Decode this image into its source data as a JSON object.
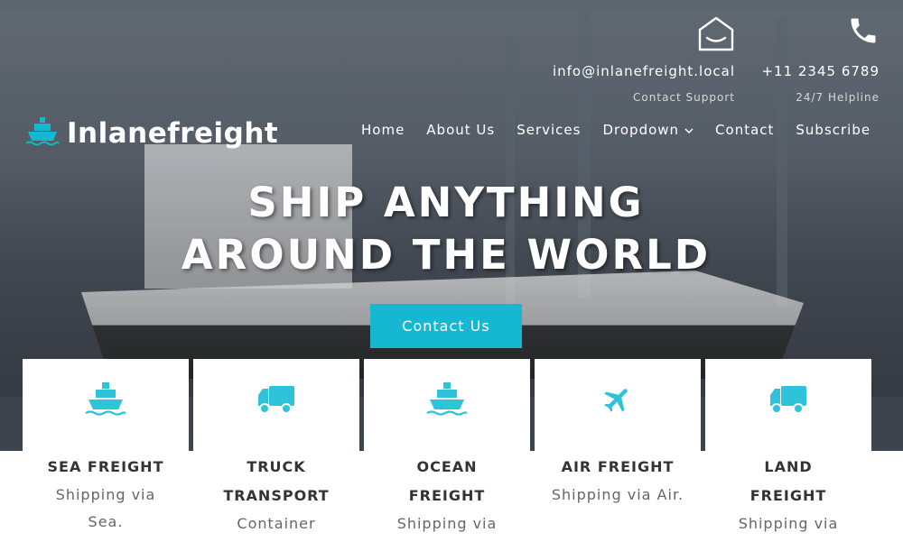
{
  "brand": {
    "name": "Inlanefreight",
    "icon": "ship-icon"
  },
  "contact": {
    "email": {
      "value": "info@inlanefreight.local",
      "label": "Contact Support",
      "icon": "envelope-open-icon"
    },
    "phone": {
      "value": "+11 2345 6789",
      "label": "24/7 Helpline",
      "icon": "phone-icon"
    }
  },
  "nav": {
    "items": [
      {
        "label": "Home"
      },
      {
        "label": "About Us"
      },
      {
        "label": "Services"
      },
      {
        "label": "Dropdown"
      },
      {
        "label": "Contact"
      },
      {
        "label": "Subscribe"
      }
    ]
  },
  "hero": {
    "line1": "SHIP ANYTHING",
    "line2": "AROUND THE WORLD",
    "cta": "Contact Us"
  },
  "services": [
    {
      "title": "SEA FREIGHT",
      "desc": "Shipping via Sea.",
      "icon": "ship-icon"
    },
    {
      "title": "TRUCK TRANSPORT",
      "desc": "Container Shipping.",
      "icon": "truck-icon"
    },
    {
      "title": "OCEAN FREIGHT",
      "desc": "Shipping via Ocean.",
      "icon": "ship-icon"
    },
    {
      "title": "AIR FREIGHT",
      "desc": "Shipping via Air.",
      "icon": "plane-icon"
    },
    {
      "title": "LAND FREIGHT",
      "desc": "Shipping via vehicles.",
      "icon": "truck-icon"
    }
  ],
  "colors": {
    "accent": "#16b8d1",
    "title": "#333333",
    "text": "#666666"
  }
}
